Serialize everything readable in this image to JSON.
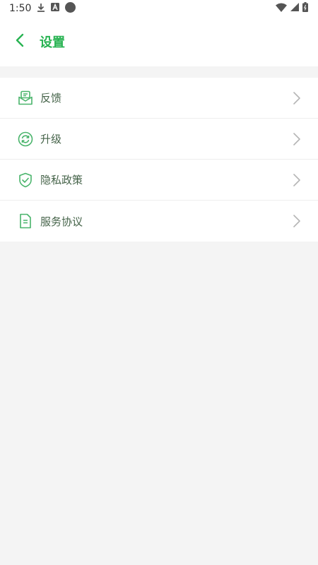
{
  "status_bar": {
    "time": "1:50",
    "icons": [
      "download-icon",
      "a-app-icon",
      "circle-icon",
      "wifi-icon",
      "cell-signal-icon",
      "battery-icon"
    ]
  },
  "header": {
    "back_icon": "chevron-left-icon",
    "title": "设置"
  },
  "colors": {
    "accent": "#28b352",
    "icon_green": "#49b46b",
    "label": "#456349",
    "chevron": "#b5b5b5",
    "background": "#f4f4f4"
  },
  "menu": {
    "items": [
      {
        "label": "反馈",
        "icon": "feedback-mail-icon"
      },
      {
        "label": "升级",
        "icon": "refresh-upgrade-icon"
      },
      {
        "label": "隐私政策",
        "icon": "shield-check-icon"
      },
      {
        "label": "服务协议",
        "icon": "document-icon"
      }
    ]
  }
}
